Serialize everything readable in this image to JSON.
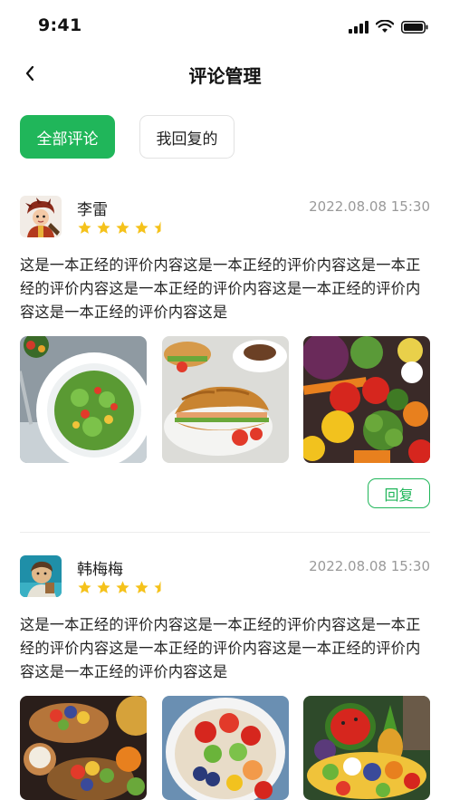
{
  "status_bar": {
    "time": "9:41"
  },
  "nav": {
    "title": "评论管理"
  },
  "filters": [
    {
      "label": "全部评论",
      "active": true
    },
    {
      "label": "我回复的",
      "active": false
    }
  ],
  "reviews": [
    {
      "name": "李雷",
      "date": "2022.08.08 15:30",
      "rating": 4.5,
      "text": "这是一本正经的评价内容这是一本正经的评价内容这是一本正经的评价内容这是一本正经的评价内容这是一本正经的评价内容这是一本正经的评价内容这是",
      "reply_label": "回复"
    },
    {
      "name": "韩梅梅",
      "date": "2022.08.08 15:30",
      "rating": 4.5,
      "text": "这是一本正经的评价内容这是一本正经的评价内容这是一本正经的评价内容这是一本正经的评价内容这是一本正经的评价内容这是一本正经的评价内容这是"
    }
  ],
  "colors": {
    "accent": "#20b65a",
    "star": "#f5c21b",
    "muted": "#999999"
  }
}
